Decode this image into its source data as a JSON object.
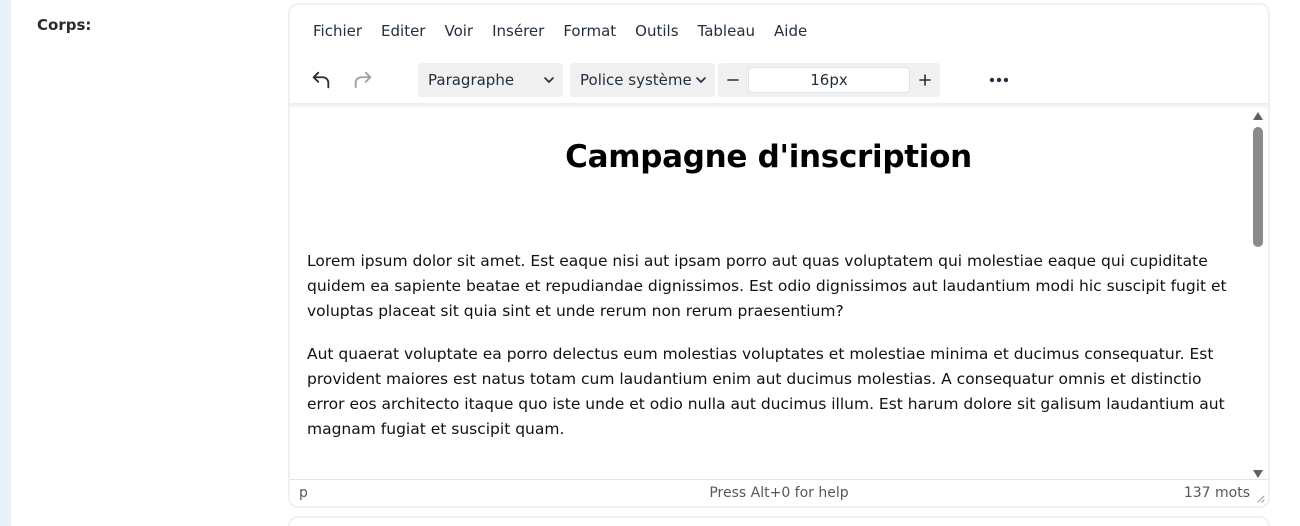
{
  "field": {
    "label": "Corps:"
  },
  "menubar": {
    "items": [
      "Fichier",
      "Editer",
      "Voir",
      "Insérer",
      "Format",
      "Outils",
      "Tableau",
      "Aide"
    ]
  },
  "toolbar": {
    "undo_icon": "undo-icon",
    "redo_icon": "redo-icon",
    "block_format": "Paragraphe",
    "font_family": "Police système",
    "font_size": "16px",
    "decrease_icon": "minus-icon",
    "increase_icon": "plus-icon",
    "more_icon": "more-horizontal-icon"
  },
  "content": {
    "heading": "Campagne d'inscription",
    "paragraphs": [
      "Lorem ipsum dolor sit amet. Est eaque nisi aut ipsam porro aut quas voluptatem qui molestiae eaque qui cupiditate quidem ea sapiente beatae et repudiandae dignissimos. Est odio dignissimos aut laudantium modi hic suscipit fugit et voluptas placeat sit quia sint et unde rerum non rerum praesentium?",
      "Aut quaerat voluptate ea porro delectus eum molestias voluptates et molestiae minima et ducimus consequatur. Est provident maiores est natus totam cum laudantium enim aut ducimus molestias. A consequatur omnis et distinctio error eos architecto itaque quo iste unde et odio nulla aut ducimus illum. Est harum dolore sit galisum laudantium aut magnam fugiat et suscipit quam."
    ]
  },
  "statusbar": {
    "path": "p",
    "help": "Press Alt+0 for help",
    "word_count": "137 mots"
  },
  "colors": {
    "text": "#222f3e",
    "toolbar_bg": "#f0f0f1",
    "border": "#eef0f2",
    "scroll_thumb": "#8a8a8a"
  }
}
